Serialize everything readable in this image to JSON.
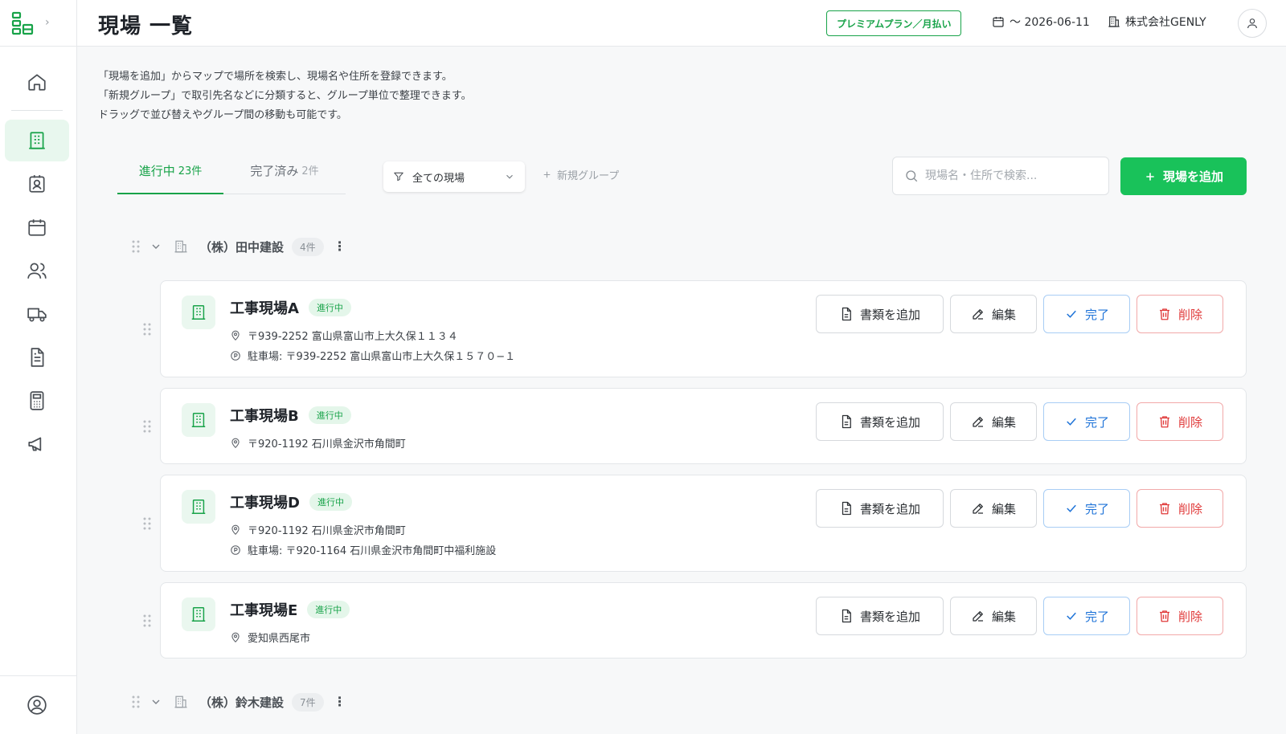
{
  "header": {
    "title": "現場 一覧",
    "plan_badge": "プレミアムプラン／月払い",
    "date": "〜 2026-06-11",
    "company": "株式会社GENLY"
  },
  "sidebar": {
    "items": [
      {
        "icon": "home-icon",
        "active": false
      },
      {
        "icon": "building-icon",
        "active": true
      },
      {
        "icon": "id-badge-icon",
        "active": false
      },
      {
        "icon": "calendar-icon",
        "active": false
      },
      {
        "icon": "users-icon",
        "active": false
      },
      {
        "icon": "truck-icon",
        "active": false
      },
      {
        "icon": "document-icon",
        "active": false
      },
      {
        "icon": "calculator-icon",
        "active": false
      },
      {
        "icon": "megaphone-icon",
        "active": false
      }
    ]
  },
  "intro": {
    "line1": "「現場を追加」からマップで場所を検索し、現場名や住所を登録できます。",
    "line2": "「新規グループ」で取引先名などに分類すると、グループ単位で整理できます。",
    "line3": "ドラッグで並び替えやグループ間の移動も可能です。"
  },
  "tabs": {
    "active": {
      "label": "進行中",
      "count": "23件"
    },
    "done": {
      "label": "完了済み",
      "count": "2件"
    }
  },
  "filter": {
    "label": "全ての現場"
  },
  "new_group": {
    "label": "新規グループ"
  },
  "search": {
    "placeholder": "現場名・住所で検索..."
  },
  "add_site": {
    "label": "現場を追加"
  },
  "buttons": {
    "add_doc": "書類を追加",
    "edit": "編集",
    "done": "完了",
    "delete": "削除"
  },
  "groups": [
    {
      "name": "（株）田中建設",
      "count": "4件"
    },
    {
      "name": "（株）鈴木建設",
      "count": "7件"
    }
  ],
  "sites": [
    {
      "name": "工事現場A",
      "status": "進行中",
      "address": "〒939-2252 富山県富山市上大久保１１３４",
      "parking": "駐車場: 〒939-2252 富山県富山市上大久保１５７０−１"
    },
    {
      "name": "工事現場B",
      "status": "進行中",
      "address": "〒920-1192 石川県金沢市角間町"
    },
    {
      "name": "工事現場D",
      "status": "進行中",
      "address": "〒920-1192 石川県金沢市角間町",
      "parking": "駐車場: 〒920-1164 石川県金沢市角間町中福利施設"
    },
    {
      "name": "工事現場E",
      "status": "進行中",
      "address": "愛知県西尾市"
    }
  ],
  "colors": {
    "accent": "#18a349",
    "primary_button": "#19c25a",
    "done": "#1e73d8",
    "delete": "#e03a3a"
  }
}
